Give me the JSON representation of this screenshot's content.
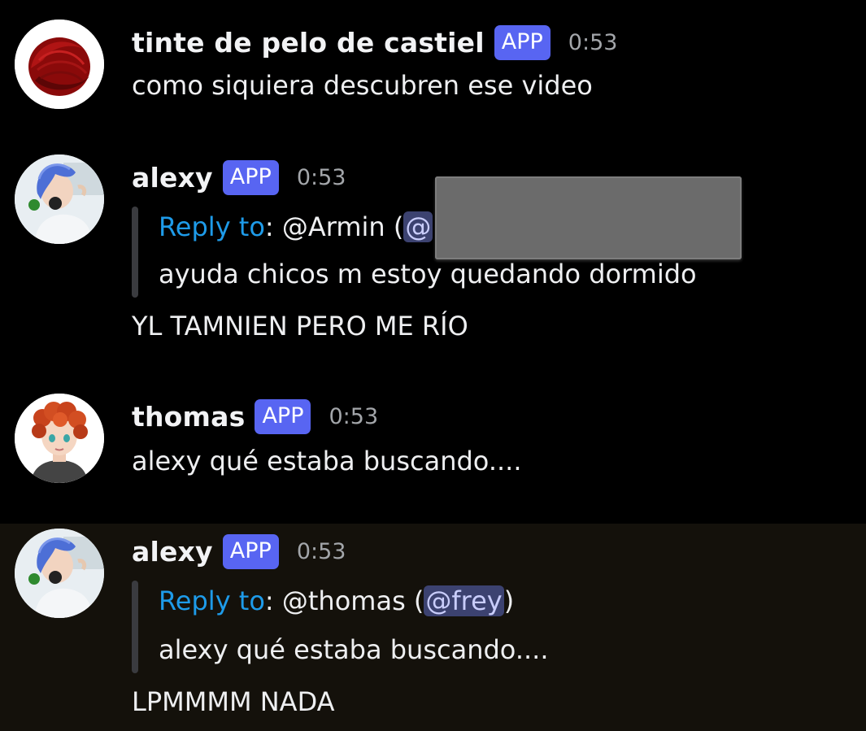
{
  "messages": [
    {
      "username": "tinte de pelo de castiel",
      "badge": "APP",
      "time": "0:53",
      "text": "como siquiera descubren ese video"
    },
    {
      "username": "alexy",
      "badge": "APP",
      "time": "0:53",
      "reply_label": "Reply to",
      "reply_prefix": ": @Armin (",
      "reply_mention": "@",
      "reply_suffix": ")",
      "reply_text": "ayuda chicos m estoy quedando dormido",
      "text": "YL TAMNIEN PERO ME RÍO"
    },
    {
      "username": "thomas",
      "badge": "APP",
      "time": "0:53",
      "text": "alexy qué estaba buscando...."
    },
    {
      "username": "alexy",
      "badge": "APP",
      "time": "0:53",
      "reply_label": "Reply to",
      "reply_prefix": ": @thomas (",
      "reply_mention": "@frey",
      "reply_suffix": ")",
      "reply_text": "alexy qué estaba buscando....",
      "text": "LPMMMM NADA"
    }
  ],
  "colors": {
    "background": "#000000",
    "highlight_background": "#14110b",
    "badge": "#5865f2",
    "reply_label": "#1e9be9",
    "mention_bg": "#3c4270",
    "mention_text": "#c9cdfb"
  },
  "icons": {
    "castiel_avatar": "red-hair-swatch-avatar",
    "alexy_avatar": "blue-haired-character-avatar",
    "thomas_avatar": "red-curly-haired-character-avatar"
  }
}
